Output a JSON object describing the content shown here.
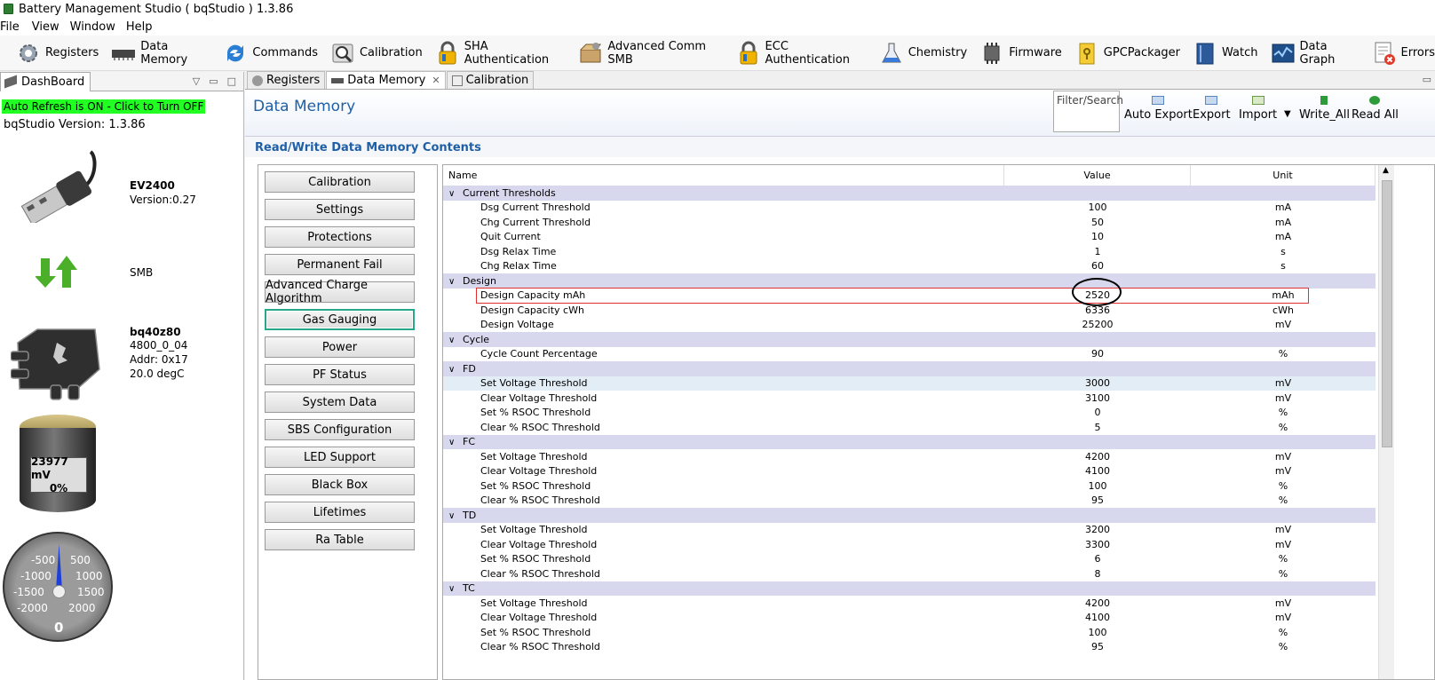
{
  "window": {
    "title": "Battery Management Studio ( bqStudio ) 1.3.86"
  },
  "menu": [
    "File",
    "View",
    "Window",
    "Help"
  ],
  "toolbar": [
    {
      "label": "Registers",
      "icon": "gear-icon"
    },
    {
      "label": "Data Memory",
      "icon": "memory-chip-icon"
    },
    {
      "label": "Commands",
      "icon": "refresh-arrows-icon"
    },
    {
      "label": "Calibration",
      "icon": "calibration-icon"
    },
    {
      "label": "SHA Authentication",
      "icon": "padlock-icon"
    },
    {
      "label": "Advanced Comm SMB",
      "icon": "comm-box-icon"
    },
    {
      "label": "ECC Authentication",
      "icon": "padlock-icon"
    },
    {
      "label": "Chemistry",
      "icon": "flask-icon"
    },
    {
      "label": "Firmware",
      "icon": "chip-icon"
    },
    {
      "label": "GPCPackager",
      "icon": "padlock-yellow-icon"
    },
    {
      "label": "Watch",
      "icon": "book-icon"
    },
    {
      "label": "Data Graph",
      "icon": "graph-icon"
    },
    {
      "label": "Errors",
      "icon": "error-document-icon"
    }
  ],
  "dashboard": {
    "tab_label": "DashBoard",
    "auto_refresh": "Auto Refresh is ON - Click to Turn OFF",
    "version": "bqStudio Version:  1.3.86",
    "adapter": {
      "name": "EV2400",
      "version": "Version:0.27"
    },
    "bus": "SMB",
    "device": {
      "name": "bq40z80",
      "fw": "4800_0_04",
      "addr": "Addr: 0x17",
      "temp": "20.0 degC"
    },
    "battery": {
      "voltage": "23977 mV",
      "percent": "0%"
    },
    "gauge": {
      "value": "0",
      "left_labels": [
        "-500",
        "-1000",
        "-1500",
        "-2000"
      ],
      "right_labels": [
        "500",
        "1000",
        "1500",
        "2000"
      ]
    }
  },
  "tabs": [
    "Registers",
    "Data Memory",
    "Calibration"
  ],
  "data_memory": {
    "title": "Data Memory",
    "filter_placeholder": "Filter/Search",
    "actions": [
      "Auto Export",
      "Export",
      "Import",
      "Write_All",
      "Read All"
    ],
    "section_title": "Read/Write Data Memory Contents",
    "categories": [
      "Calibration",
      "Settings",
      "Protections",
      "Permanent Fail",
      "Advanced Charge Algorithm",
      "Gas Gauging",
      "Power",
      "PF Status",
      "System Data",
      "SBS Configuration",
      "LED Support",
      "Black Box",
      "Lifetimes",
      "Ra Table"
    ],
    "selected_category": "Gas Gauging",
    "columns": {
      "name": "Name",
      "value": "Value",
      "unit": "Unit"
    },
    "rows": [
      {
        "group": "Current Thresholds"
      },
      {
        "name": "Dsg Current Threshold",
        "value": "100",
        "unit": "mA"
      },
      {
        "name": "Chg Current Threshold",
        "value": "50",
        "unit": "mA"
      },
      {
        "name": "Quit Current",
        "value": "10",
        "unit": "mA"
      },
      {
        "name": "Dsg Relax Time",
        "value": "1",
        "unit": "s"
      },
      {
        "name": "Chg Relax Time",
        "value": "60",
        "unit": "s"
      },
      {
        "group": "Design"
      },
      {
        "name": "Design Capacity mAh",
        "value": "2520",
        "unit": "mAh"
      },
      {
        "name": "Design Capacity cWh",
        "value": "6336",
        "unit": "cWh"
      },
      {
        "name": "Design Voltage",
        "value": "25200",
        "unit": "mV"
      },
      {
        "group": "Cycle"
      },
      {
        "name": "Cycle Count Percentage",
        "value": "90",
        "unit": "%"
      },
      {
        "group": "FD"
      },
      {
        "name": "Set Voltage Threshold",
        "value": "3000",
        "unit": "mV"
      },
      {
        "name": "Clear Voltage Threshold",
        "value": "3100",
        "unit": "mV"
      },
      {
        "name": "Set % RSOC Threshold",
        "value": "0",
        "unit": "%"
      },
      {
        "name": "Clear % RSOC Threshold",
        "value": "5",
        "unit": "%"
      },
      {
        "group": "FC"
      },
      {
        "name": "Set Voltage Threshold",
        "value": "4200",
        "unit": "mV"
      },
      {
        "name": "Clear Voltage Threshold",
        "value": "4100",
        "unit": "mV"
      },
      {
        "name": "Set % RSOC Threshold",
        "value": "100",
        "unit": "%"
      },
      {
        "name": "Clear % RSOC Threshold",
        "value": "95",
        "unit": "%"
      },
      {
        "group": "TD"
      },
      {
        "name": "Set Voltage Threshold",
        "value": "3200",
        "unit": "mV"
      },
      {
        "name": "Clear Voltage Threshold",
        "value": "3300",
        "unit": "mV"
      },
      {
        "name": "Set % RSOC Threshold",
        "value": "6",
        "unit": "%"
      },
      {
        "name": "Clear % RSOC Threshold",
        "value": "8",
        "unit": "%"
      },
      {
        "group": "TC"
      },
      {
        "name": "Set Voltage Threshold",
        "value": "4200",
        "unit": "mV"
      },
      {
        "name": "Clear Voltage Threshold",
        "value": "4100",
        "unit": "mV"
      },
      {
        "name": "Set % RSOC Threshold",
        "value": "100",
        "unit": "%"
      },
      {
        "name": "Clear % RSOC Threshold",
        "value": "95",
        "unit": "%"
      }
    ]
  },
  "colors": {
    "accent": "#1f5fa6",
    "refresh_bg": "#22ff22",
    "group_bg": "#d7d7ee",
    "highlight_box": "#e03030"
  }
}
